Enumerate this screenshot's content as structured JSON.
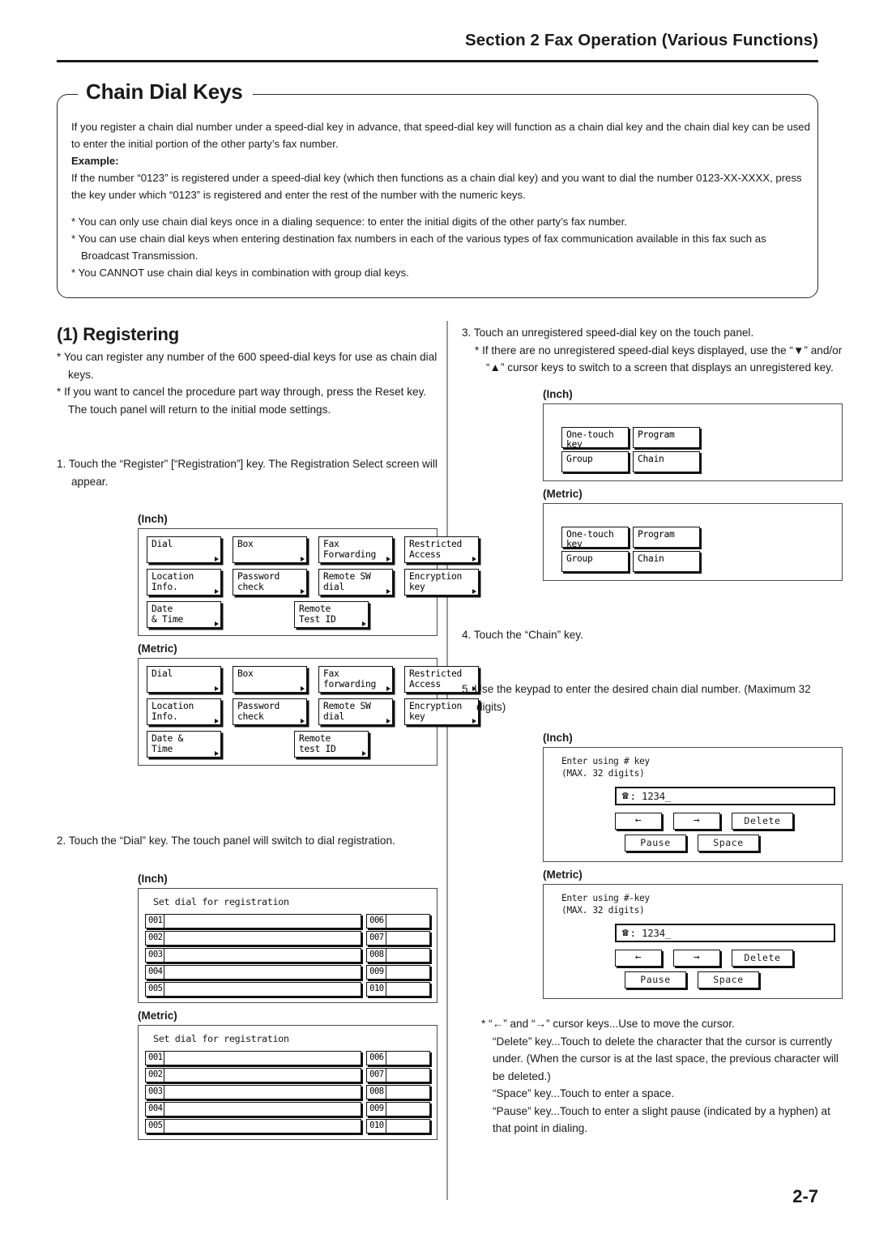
{
  "header": {
    "section": "Section 2  Fax Operation (Various Functions)"
  },
  "title_box": {
    "title": "Chain Dial Keys",
    "intro": "If you register a chain dial number under a speed-dial key in advance, that speed-dial key will function as a chain dial key and the chain dial key can be used to enter the initial portion of the other party’s fax number.",
    "example_label": "Example:",
    "example_text": "If the number “0123” is registered under a speed-dial key (which then functions as a chain dial key) and you want to dial the number 0123-XX-XXXX, press the key under which “0123” is registered and enter the rest of the number with the numeric keys.",
    "notes": [
      "* You can only use chain dial keys once in a dialing sequence: to enter the initial digits of the other party’s fax number.",
      "* You can use chain dial keys when entering destination fax numbers in each of the various types of fax communication available in this fax such as Broadcast Transmission.",
      "* You CANNOT use chain dial keys in combination with group dial keys."
    ]
  },
  "left_column": {
    "heading": "(1) Registering",
    "bullets": [
      "* You can register any number of the 600 speed-dial keys for use as chain dial keys.",
      "* If you want to cancel the procedure part way through, press the Reset key. The touch panel will return to the initial mode settings."
    ],
    "step1": "1. Touch the “Register” [“Registration”] key. The Registration Select screen will appear.",
    "step2": "2. Touch the “Dial” key. The touch panel will switch to dial registration.",
    "inch_label": "(Inch)",
    "metric_label": "(Metric)",
    "regsel_inch": [
      [
        "Dial",
        "Box",
        "Fax\nForwarding",
        "Restricted\nAccess"
      ],
      [
        "Location\nInfo.",
        "Password\ncheck",
        "Remote SW\ndial",
        "Encryption\nkey"
      ],
      [
        "Date\n& Time",
        "",
        "Remote\nTest ID",
        ""
      ]
    ],
    "regsel_metric": [
      [
        "Dial",
        "Box",
        "Fax\nforwarding",
        "Restricted\nAccess"
      ],
      [
        "Location\nInfo.",
        "Password\ncheck",
        "Remote SW\ndial",
        "Encryption\nkey"
      ],
      [
        "Date &\nTime",
        "",
        "Remote\ntest ID",
        ""
      ]
    ],
    "setdial_title": "Set dial for registration",
    "setdial_left_indices": [
      "001",
      "002",
      "003",
      "004",
      "005"
    ],
    "setdial_right_indices": [
      "006",
      "007",
      "008",
      "009",
      "010"
    ]
  },
  "right_column": {
    "step3": "3. Touch an unregistered speed-dial key on the touch panel.",
    "step3_note": "* If there are no unregistered speed-dial keys displayed, use the “▼” and/or “▲” cursor keys to switch to a screen that displays an unregistered key.",
    "step4": "4. Touch the “Chain” key.",
    "step5": "5. Use the keypad to enter the desired chain dial number. (Maximum 32 digits)",
    "inch_label": "(Inch)",
    "metric_label": "(Metric)",
    "onetouch_keys": [
      [
        "One-touch\nkey",
        "Program"
      ],
      [
        "Group",
        "Chain"
      ]
    ],
    "enter_inch": {
      "caption": "Enter using # key\n(MAX. 32 digits)",
      "phone_icon": "☎",
      "value": ": 1234_",
      "buttons_row1": [
        "←",
        "→",
        "Delete"
      ],
      "buttons_row2": [
        "Pause",
        "Space"
      ]
    },
    "enter_metric": {
      "caption": "Enter using #-key\n(MAX. 32 digits)",
      "phone_icon": "☎",
      "value": ": 1234_",
      "buttons_row1": [
        "←",
        "→",
        "Delete"
      ],
      "buttons_row2": [
        "Pause",
        "Space"
      ]
    },
    "footnotes": [
      "* “←” and “→” cursor keys...Use to move the cursor.",
      "“Delete” key...Touch to delete the character that the cursor is currently under. (When the cursor is at the last space, the previous character will be deleted.)",
      "“Space” key...Touch to enter a space.",
      "“Pause” key...Touch to enter a slight pause (indicated by a hyphen) at that point in dialing."
    ]
  },
  "footer": {
    "page_number": "2-7"
  }
}
